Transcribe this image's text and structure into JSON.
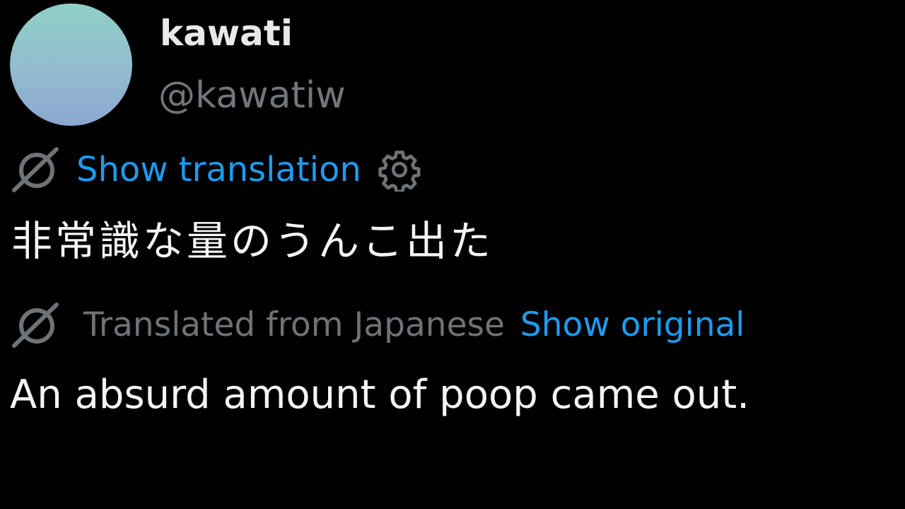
{
  "author": {
    "display_name": "kawati",
    "handle": "@kawatiw",
    "avatar_colors": [
      "#8fd0c8",
      "#8aa6cf"
    ]
  },
  "translation_controls": {
    "show_translation_label": "Show translation",
    "translated_from_label": "Translated from Japanese",
    "show_original_label": "Show original",
    "link_color": "#1d9bf0",
    "icons": [
      "translate-icon",
      "gear-icon"
    ]
  },
  "tweet": {
    "original_text": "非常識な量のうんこ出た",
    "translated_text": "An absurd amount of poop came out."
  }
}
